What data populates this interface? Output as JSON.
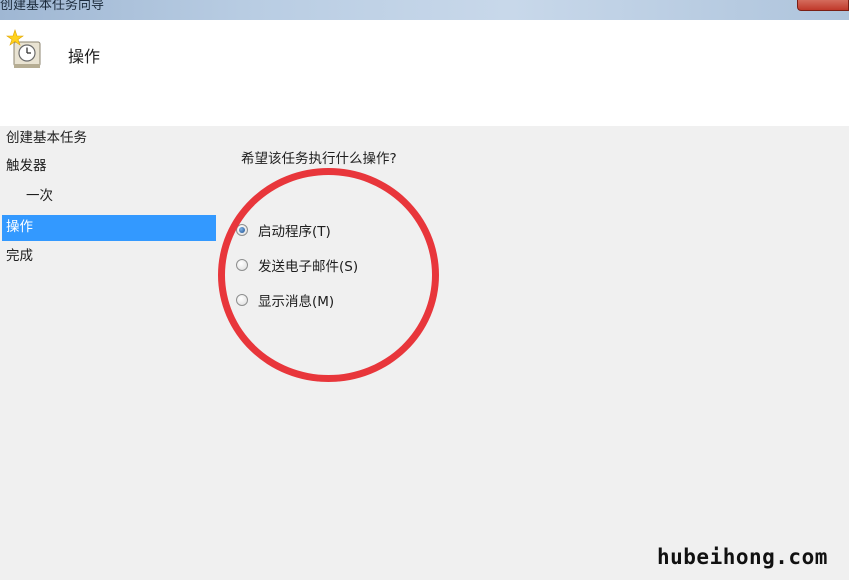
{
  "window": {
    "title": "创建基本任务向导"
  },
  "header": {
    "title": "操作",
    "icon": "task-clock-icon"
  },
  "nav": {
    "items": [
      {
        "label": "创建基本任务"
      },
      {
        "label": "触发器"
      },
      {
        "label": "一次"
      },
      {
        "label": "操作"
      },
      {
        "label": "完成"
      }
    ],
    "selected": "操作"
  },
  "main": {
    "question": "希望该任务执行什么操作?",
    "options": [
      {
        "label": "启动程序(T)",
        "checked": true
      },
      {
        "label": "发送电子邮件(S)",
        "checked": false
      },
      {
        "label": "显示消息(M)",
        "checked": false
      }
    ]
  },
  "colors": {
    "selection": "#3399ff",
    "annotation": "#e8363b",
    "header_bg": "#ffffff",
    "body_bg": "#f0f0f0"
  },
  "watermark": "hubeihong.com"
}
